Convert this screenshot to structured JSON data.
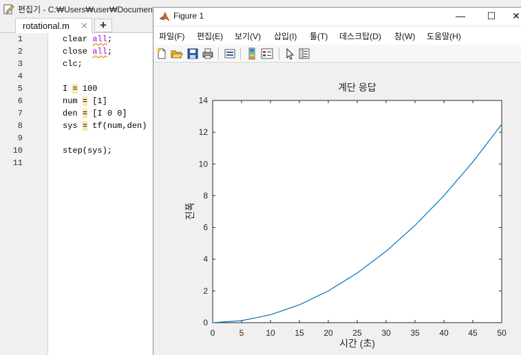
{
  "editor": {
    "title": "편집기 - C:₩Users₩user₩Documents",
    "tab_label": "rotational.m",
    "tab_close": "✕",
    "add_tab": "+",
    "line_numbers": [
      "1",
      "2",
      "3",
      "4",
      "5",
      "6",
      "7",
      "8",
      "9",
      "10",
      "11"
    ],
    "code": {
      "l1_a": "clear ",
      "l1_b": "all",
      "l1_c": ";",
      "l2_a": "close ",
      "l2_b": "all",
      "l2_c": ";",
      "l3": "clc;",
      "l5_a": "I ",
      "l5_b": "=",
      "l5_c": " 100",
      "l6_a": "num ",
      "l6_b": "=",
      "l6_c": " [1]",
      "l7_a": "den ",
      "l7_b": "=",
      "l7_c": " [I 0 0]",
      "l8_a": "sys ",
      "l8_b": "=",
      "l8_c": " tf(num,den)",
      "l10": "step(sys);"
    }
  },
  "figure": {
    "title": "Figure 1",
    "minimize": "—",
    "maximize": "☐",
    "close": "✕",
    "menu": [
      "파일(F)",
      "편집(E)",
      "보기(V)",
      "삽입(I)",
      "툴(T)",
      "데스크탑(D)",
      "창(W)",
      "도움말(H)"
    ],
    "toolbar_icons": [
      "new-figure-icon",
      "open-file-icon",
      "save-icon",
      "print-icon",
      "link-plot-icon",
      "colorbar-icon",
      "legend-icon",
      "edit-plot-arrow-icon",
      "property-inspector-icon"
    ]
  },
  "chart_data": {
    "type": "line",
    "title": "계단 응답",
    "xlabel": "시간 (초)",
    "ylabel": "진폭",
    "xlim": [
      0,
      50
    ],
    "ylim": [
      0,
      14
    ],
    "xticks": [
      0,
      5,
      10,
      15,
      20,
      25,
      30,
      35,
      40,
      45,
      50
    ],
    "yticks": [
      0,
      2,
      4,
      6,
      8,
      10,
      12,
      14
    ],
    "grid": false,
    "series": [
      {
        "color": "#0072bd",
        "x": [
          0,
          5,
          10,
          15,
          20,
          25,
          30,
          35,
          40,
          45,
          50
        ],
        "y": [
          0,
          0.125,
          0.5,
          1.125,
          2.0,
          3.125,
          4.5,
          6.125,
          8.0,
          10.125,
          12.5
        ]
      }
    ]
  }
}
